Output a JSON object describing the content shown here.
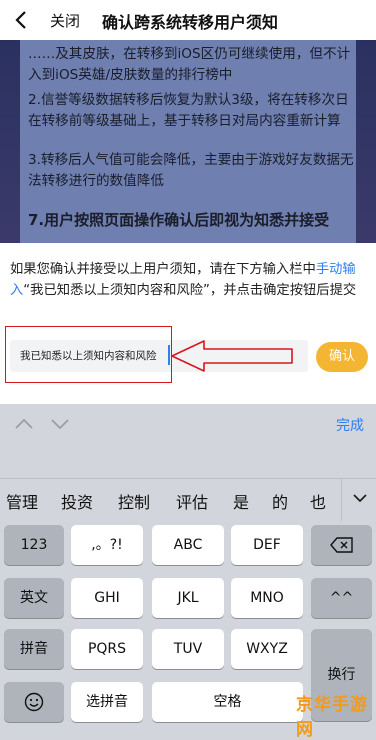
{
  "nav": {
    "close_label": "关闭",
    "title": "确认跨系统转移用户须知"
  },
  "background_text": {
    "p1": "……及其皮肤，在转移到iOS区仍可继续使用，但不计入到iOS英雄/皮肤数量的排行榜中",
    "p2": "2.信誉等级数据转移后恢复为默认3级，将在转移次日在转移前等级基础上，基于转移日对局内容重新计算",
    "p3": "3.转移后人气值可能会降低，主要由于游戏好友数据无法转移进行的数值降低",
    "p4": "7.用户按照页面操作确认后即视为知悉并接受"
  },
  "notice": {
    "before": "如果您确认并接受以上用户须知，请在下方输入栏中",
    "link": "手动输入",
    "after": "“我已知悉以上须知内容和风险”，并点击确定按钮后提交"
  },
  "input": {
    "value": "我已知悉以上须知内容和风险"
  },
  "confirm_label": "确认",
  "keyboard": {
    "done_label": "完成",
    "candidates": [
      "管理",
      "投资",
      "控制",
      "评估",
      "是",
      "的",
      "也"
    ],
    "row1": [
      "123",
      ",。?!",
      "ABC",
      "DEF"
    ],
    "row2": [
      "英文",
      "GHI",
      "JKL",
      "MNO",
      "^^"
    ],
    "row3": [
      "拼音",
      "PQRS",
      "TUV",
      "WXYZ"
    ],
    "row4": [
      "选拼音",
      "空格"
    ],
    "enter_label": "换行"
  },
  "watermark": "京华手游网",
  "colors": {
    "accent": "#2f7ff0",
    "confirm": "#f4b533",
    "annotation_red": "#d9161c"
  }
}
